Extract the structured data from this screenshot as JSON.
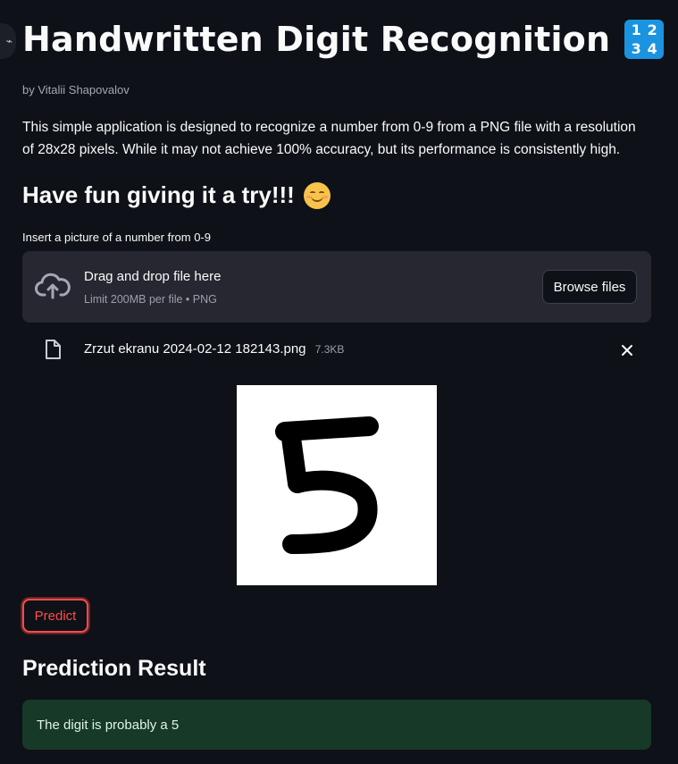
{
  "header": {
    "title": "Handwritten Digit Recognition",
    "title_emoji": [
      "1",
      "2",
      "3",
      "4"
    ],
    "author": "by Vitalii Shapovalov"
  },
  "intro": {
    "text": "This simple application is designed to recognize a number from 0-9 from a PNG file with a resolution of 28x28 pixels. While it may not achieve 100% accuracy, but its performance is consistently high."
  },
  "subtitle": "Have fun giving it a try!!!",
  "uploader": {
    "label": "Insert a picture of a number from 0-9",
    "drop_text": "Drag and drop file here",
    "limit_text": "Limit 200MB per file • PNG",
    "browse_label": "Browse files",
    "file_name": "Zrzut ekranu 2024-02-12 182143.png",
    "file_size": "7.3KB"
  },
  "preview": {
    "depicted_digit": "5",
    "background": "#ffffff"
  },
  "actions": {
    "predict_label": "Predict"
  },
  "result": {
    "title": "Prediction Result",
    "message": "The digit is probably a 5"
  },
  "colors": {
    "background": "#0e1117",
    "accent": "#ff4b4b",
    "success_bg": "#173928",
    "panel": "#262730",
    "emoji_blue": "#1a93e0"
  },
  "icons": {
    "title_emoji": "input-numbers-icon",
    "subtitle_emoji": "smiling-face-icon",
    "upload": "cloud-upload-icon",
    "file": "file-icon",
    "remove": "close-icon"
  }
}
